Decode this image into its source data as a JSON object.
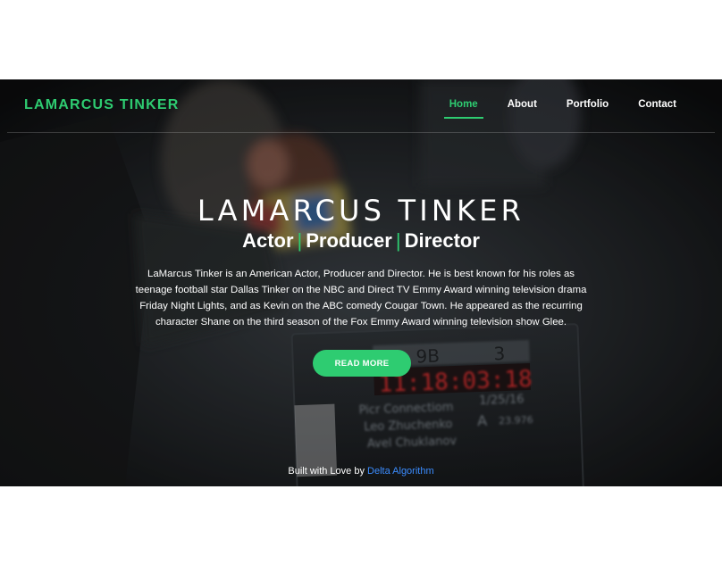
{
  "brand": "LAMARCUS TINKER",
  "nav": {
    "items": [
      "Home",
      "About",
      "Portfolio",
      "Contact"
    ],
    "active": "Home"
  },
  "hero": {
    "title": "LAMARCUS TINKER",
    "roles": [
      "Actor",
      "Producer",
      "Director"
    ],
    "role_separator": "|",
    "bio": "LaMarcus Tinker is an American Actor, Producer and Director. He is best known for his roles as teenage football star Dallas Tinker on the NBC and Direct TV Emmy Award winning television drama Friday Night Lights, and as Kevin on the ABC comedy Cougar Town. He appeared as the recurring character Shane on the third season of the Fox Emmy Award winning television show Glee.",
    "cta_label": "READ MORE",
    "background": {
      "slate_lines": [
        "9B",
        "3",
        "11:18:03:18",
        "Picr Connectiom",
        "1/25/16",
        "Leo Zhuchenko",
        "A",
        "23.976",
        "Avel Chuklanov"
      ]
    }
  },
  "footer": {
    "prefix": "Built with Love by",
    "link_text": "Delta Algorithm"
  },
  "colors": {
    "accent": "#2ecc71",
    "link": "#3b8cff",
    "text": "#ffffff",
    "page": "#ffffff"
  }
}
